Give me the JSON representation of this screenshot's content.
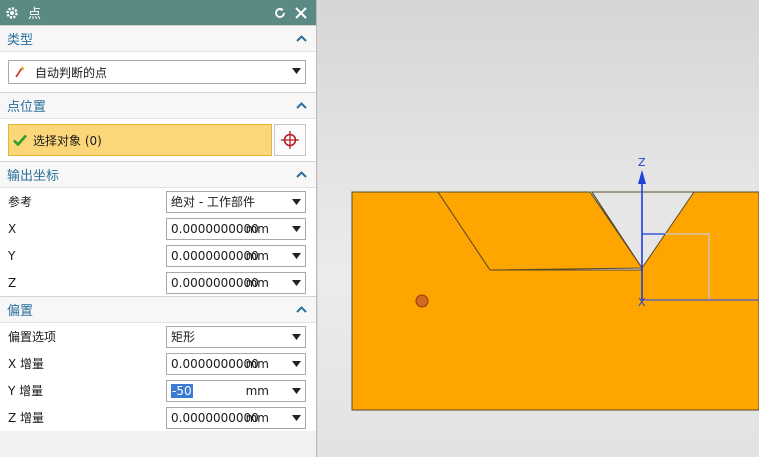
{
  "dialog": {
    "title": "点",
    "type_section": {
      "title": "类型",
      "value": "自动判断的点"
    },
    "point_location": {
      "title": "点位置",
      "select_label": "选择对象 (0)"
    },
    "output_coords": {
      "title": "输出坐标",
      "reference_label": "参考",
      "reference_value": "绝对 - 工作部件",
      "fields": [
        {
          "label": "X",
          "value": "0.0000000000",
          "unit": "mm"
        },
        {
          "label": "Y",
          "value": "0.0000000000",
          "unit": "mm"
        },
        {
          "label": "Z",
          "value": "0.0000000000",
          "unit": "mm"
        }
      ]
    },
    "offset": {
      "title": "偏置",
      "option_label": "偏置选项",
      "option_value": "矩形",
      "fields": [
        {
          "label": "X 增量",
          "value": "0.0000000000",
          "unit": "mm"
        },
        {
          "label": "Y 增量",
          "value": "-50",
          "unit": "mm"
        },
        {
          "label": "Z 增量",
          "value": "0.0000000000",
          "unit": "mm"
        }
      ]
    }
  },
  "viewport": {
    "axis_z_label": "Z",
    "axis_x_label": "X",
    "colors": {
      "part": "#ffa500",
      "axis": "#1f3fd8",
      "panel_title": "#5b8a85",
      "accent": "#2b6f9c",
      "selection": "#fcd77a"
    }
  },
  "icons": [
    "gear-icon",
    "reset-icon",
    "close-icon",
    "collapse-icon",
    "wand-icon",
    "check-icon",
    "crosshair-icon",
    "dropdown-arrow-icon"
  ]
}
